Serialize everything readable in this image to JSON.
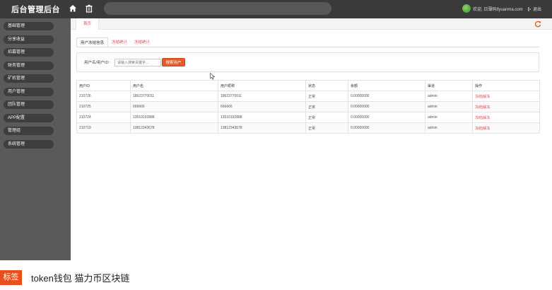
{
  "header": {
    "title": "后台管理后台",
    "welcome_text": "欢迎, 日薄码ifyuanma.com",
    "logout_label": "退出"
  },
  "sidebar": {
    "items": [
      {
        "label": "基础管理"
      },
      {
        "label": "分享收益"
      },
      {
        "label": "招募管理"
      },
      {
        "label": "财务管理"
      },
      {
        "label": "矿机管理"
      },
      {
        "label": "用户管理"
      },
      {
        "label": "团队管理"
      },
      {
        "label": "APP配置"
      },
      {
        "label": "管理组"
      },
      {
        "label": "系统管理"
      }
    ]
  },
  "tabs": {
    "home_label": "首页"
  },
  "subtabs": [
    {
      "label": "用户冻结信息",
      "active": true
    },
    {
      "label": "冻结统计",
      "active": false
    },
    {
      "label": "冻结统计",
      "active": false
    }
  ],
  "filter": {
    "label": "用户名/用户ID:",
    "placeholder": "请输入搜索关键字...",
    "button_label": "搜索用户"
  },
  "table": {
    "columns": [
      "用户ID",
      "用户名",
      "用户昵称",
      "状态",
      "余额",
      "渠道",
      "操作"
    ],
    "rows": [
      [
        "210726",
        "18623770011",
        "18623770011",
        "正常",
        "0.00000000",
        "admin",
        "冻结|解冻"
      ],
      [
        "210725",
        "666666",
        "666666",
        "正常",
        "0.00000000",
        "admin",
        "冻结|解冻"
      ],
      [
        "210724",
        "13510192888",
        "13510192888",
        "正常",
        "0.00000000",
        "admin",
        "冻结|解冻"
      ],
      [
        "210719",
        "13812343678",
        "13812343678",
        "正常",
        "0.00000000",
        "admin",
        "冻结|解冻"
      ]
    ]
  },
  "footer": {
    "tag_label": "标签",
    "tags_text": "token钱包  猫力币区块链"
  },
  "colors": {
    "accent": "#e55a2b",
    "link": "#d9534f",
    "topbar": "#3a3a3a",
    "sidebar": "#5a5a5a"
  },
  "icons": [
    "home-icon",
    "trash-icon",
    "refresh-icon",
    "logout-icon",
    "cursor-icon"
  ]
}
